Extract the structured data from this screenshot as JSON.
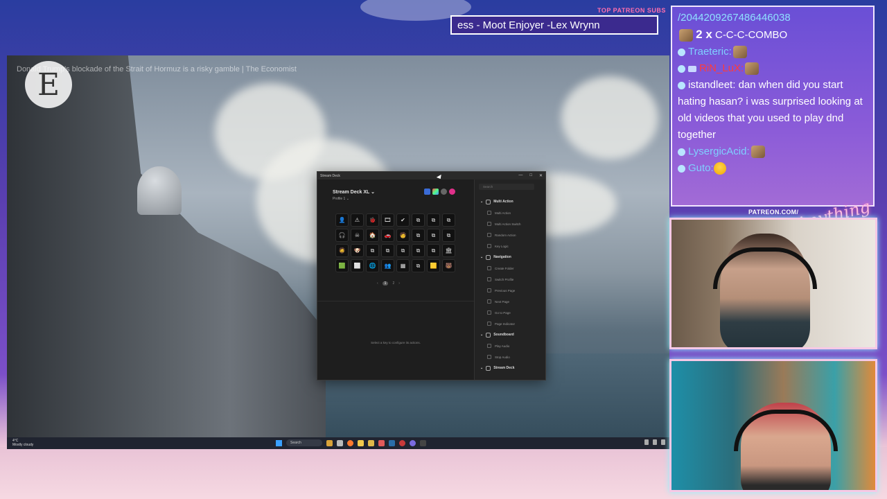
{
  "overlay": {
    "patreon_label": "TOP PATREON SUBS",
    "ticker_text": "ess - Moot Enjoyer -Lex Wrynn",
    "patreon_url": "PATREON.COM/",
    "brand_script": "Anything Else?"
  },
  "video": {
    "title": "Donald Trump's blockade of the Strait of Hormuz is a risky gamble | The Economist",
    "logo_letter": "E"
  },
  "stream_deck": {
    "window_title": "Stream Deck",
    "device_name": "Stream Deck XL ⌄",
    "profile": "Profile 1 ⌄",
    "search_placeholder": "Search",
    "pager": {
      "prev": "‹",
      "page1": "1",
      "page2": "2",
      "next": "›"
    },
    "hint": "Select a key to configure its actions.",
    "keys": [
      "👤",
      "⚠",
      "🐞",
      "🎞",
      "✔",
      "⧉",
      "⧉",
      "⧉",
      "🎧",
      "☠",
      "🏠",
      "🚗",
      "🧑",
      "⧉",
      "⧉",
      "⧉",
      "🧔",
      "🐶",
      "⧉",
      "⧉",
      "⧉",
      "⧉",
      "⧉",
      "🏛",
      "🟩",
      "⬜",
      "🌐",
      "👥",
      "▦",
      "⧉",
      "🟨",
      "🐻"
    ],
    "categories": [
      {
        "label": "Multi Action",
        "items": [
          "Multi Action",
          "Multi Action Switch",
          "Random Action",
          "Key Logic"
        ]
      },
      {
        "label": "Navigation",
        "items": [
          "Create Folder",
          "Switch Profile",
          "Previous Page",
          "Next Page",
          "Go to Page",
          "Page Indicator"
        ]
      },
      {
        "label": "Soundboard",
        "items": [
          "Play Audio",
          "Stop Audio"
        ]
      },
      {
        "label": "Stream Deck",
        "items": []
      }
    ]
  },
  "taskbar": {
    "weather_temp": "4°C",
    "weather_desc": "Mostly cloudy",
    "search_label": "Search"
  },
  "chat": {
    "header_id": "/20442092674864460​38",
    "combo_count": "2 x",
    "combo_text": "C-C-C-COMBO",
    "messages": [
      {
        "user": "Traeteric:",
        "user_color": "#7fd0ff",
        "text": ""
      },
      {
        "user": "RiN_LuX:",
        "user_color": "#ff3b3b",
        "text": ""
      },
      {
        "user": "istandleet:",
        "user_color": "#ffffff",
        "text": "dan when did you start hating hasan? i was surprised looking at old videos that you used to play dnd together"
      },
      {
        "user": "LysergicAcid:",
        "user_color": "#7fd0ff",
        "text": ""
      },
      {
        "user": "Guto:",
        "user_color": "#7fd0ff",
        "text": ""
      }
    ]
  }
}
